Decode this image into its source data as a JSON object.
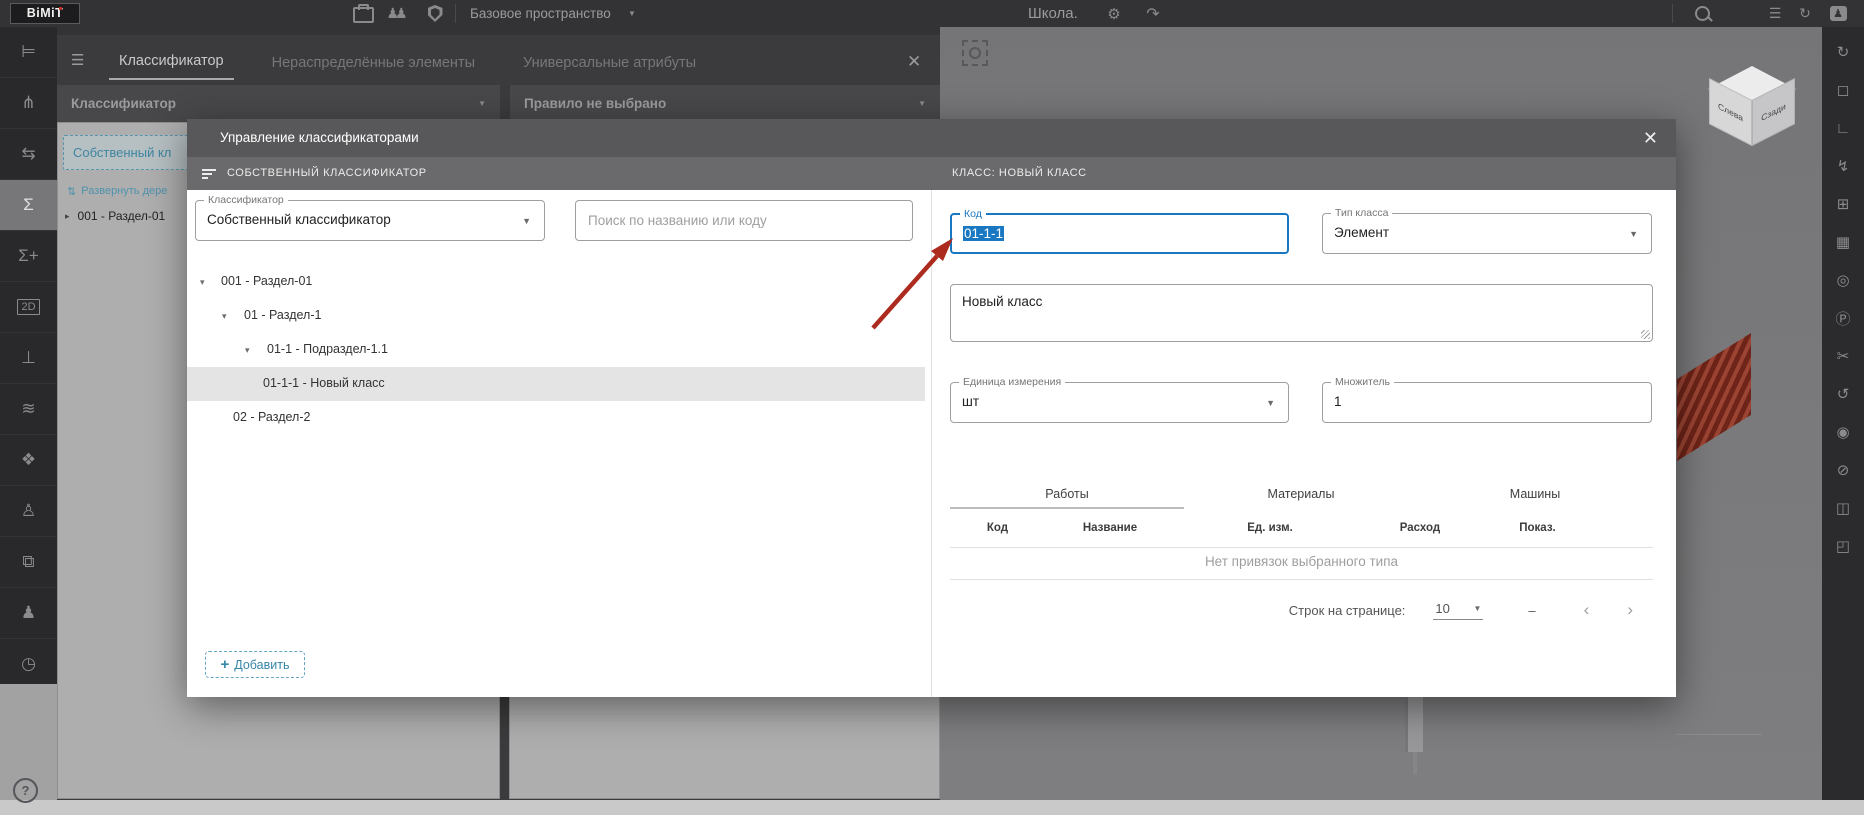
{
  "colors": {
    "accent": "#1a78c2",
    "selection_bg": "#1a78c2",
    "teal_action": "#3585a8",
    "annotation_arrow": "#ad2a1f",
    "modal_header": "#58585a"
  },
  "ui": {
    "caret": "▼",
    "tree_caret": "▾",
    "chevron_left": "‹",
    "chevron_right": "›",
    "close": "✕",
    "plus": "+",
    "node_arrow": "▸",
    "expand_icon": "⇅"
  },
  "topbar": {
    "logo": "BiMiT",
    "workspace_label": "Базовое пространство",
    "project_title": "Школа.",
    "icons": {
      "team": "♟♟",
      "gear": "⚙",
      "share": "↷",
      "list": "☰",
      "sync": "↻",
      "account": "♟"
    }
  },
  "left_sidebar": {
    "items": [
      {
        "name": "tree-structure",
        "glyph": "⊨"
      },
      {
        "name": "branch",
        "glyph": "⋔"
      },
      {
        "name": "shuffle",
        "glyph": "⇆"
      },
      {
        "name": "sum",
        "glyph": "Σ"
      },
      {
        "name": "sum-add",
        "glyph": "Σ+"
      },
      {
        "name": "sheet-2d",
        "glyph": "2D"
      },
      {
        "name": "scheme",
        "glyph": "⊥"
      },
      {
        "name": "graph",
        "glyph": "≋"
      },
      {
        "name": "plugin",
        "glyph": "❖"
      },
      {
        "name": "user-check",
        "glyph": "♙"
      },
      {
        "name": "folder-transfer",
        "glyph": "⧉"
      },
      {
        "name": "user-location",
        "glyph": "♟"
      },
      {
        "name": "gauge",
        "glyph": "◷"
      }
    ]
  },
  "right_toolbar": {
    "items": [
      {
        "name": "orbit",
        "glyph": "↻"
      },
      {
        "name": "select-frame",
        "glyph": "◻"
      },
      {
        "name": "measure",
        "glyph": "∟"
      },
      {
        "name": "flash",
        "glyph": "↯"
      },
      {
        "name": "layout",
        "glyph": "⊞"
      },
      {
        "name": "table",
        "glyph": "▦"
      },
      {
        "name": "target",
        "glyph": "◎"
      },
      {
        "name": "parking",
        "glyph": "Ⓟ"
      },
      {
        "name": "section-cut",
        "glyph": "✂"
      },
      {
        "name": "refresh",
        "glyph": "↺"
      },
      {
        "name": "visibility",
        "glyph": "◉"
      },
      {
        "name": "visibility-off",
        "glyph": "⊘"
      },
      {
        "name": "cube-view",
        "glyph": "◫"
      },
      {
        "name": "clip-box",
        "glyph": "◰"
      }
    ]
  },
  "classifier_panel": {
    "tabs": [
      "Классификатор",
      "Нераспределённые элементы",
      "Универсальные атрибуты"
    ],
    "active_tab": "Классификатор",
    "filter_left": "Классификатор",
    "filter_right": "Правило не выбрано",
    "chip": "Собственный кл",
    "expand_link": "Развернуть дере",
    "node": "001 - Раздел-01"
  },
  "viewport": {
    "cube_left_face": "Слева",
    "cube_right_face": "Сзади"
  },
  "modal": {
    "title": "Управление классификаторами",
    "left_header": "СОБСТВЕННЫЙ КЛАССИФИКАТОР",
    "right_header": "КЛАСС: НОВЫЙ КЛАСС",
    "classifier_field": {
      "label": "Классификатор",
      "value": "Собственный классификатор"
    },
    "search_placeholder": "Поиск по названию или коду",
    "tree": [
      {
        "label": "001 - Раздел-01"
      },
      {
        "label": "01 - Раздел-1"
      },
      {
        "label": "01-1 - Подраздел-1.1"
      },
      {
        "label": "01-1-1 - Новый класс"
      },
      {
        "label": "02 - Раздел-2"
      }
    ],
    "code_field": {
      "label": "Код",
      "value": "01-1-1"
    },
    "type_field": {
      "label": "Тип класса",
      "value": "Элемент"
    },
    "name_value": "Новый класс",
    "unit_field": {
      "label": "Единица измерения",
      "value": "шт"
    },
    "multiplier_field": {
      "label": "Множитель",
      "value": "1"
    },
    "binding_tabs": [
      "Работы",
      "Материалы",
      "Машины"
    ],
    "active_binding_tab": "Работы",
    "table": {
      "headers": [
        "Код",
        "Название",
        "Ед. изм.",
        "Расход",
        "Показ."
      ],
      "empty": "Нет привязок выбранного типа"
    },
    "pagination": {
      "label": "Строк на странице:",
      "value": "10",
      "range": "–"
    },
    "add_button": "Добавить"
  },
  "help": "?"
}
